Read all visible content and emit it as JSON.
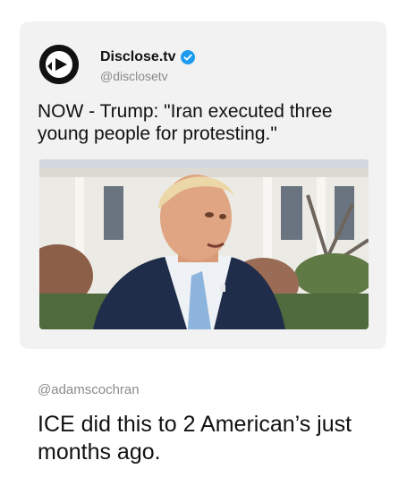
{
  "quoted_post": {
    "author": {
      "display_name": "Disclose.tv",
      "handle": "@disclosetv",
      "verified": true,
      "avatar_icon": "disclose-play-logo-icon"
    },
    "text": "NOW - Trump: \"Iran executed three young people for protesting.\"",
    "media": {
      "type": "photo"
    }
  },
  "quote": {
    "handle": "@adamscochran",
    "text": "ICE did this to 2 American’s just months ago."
  },
  "colors": {
    "card_background": "#f2f2f2",
    "verified_badge": "#1d9bf0",
    "secondary_text": "#8a8a8a",
    "primary_text": "#111111"
  }
}
